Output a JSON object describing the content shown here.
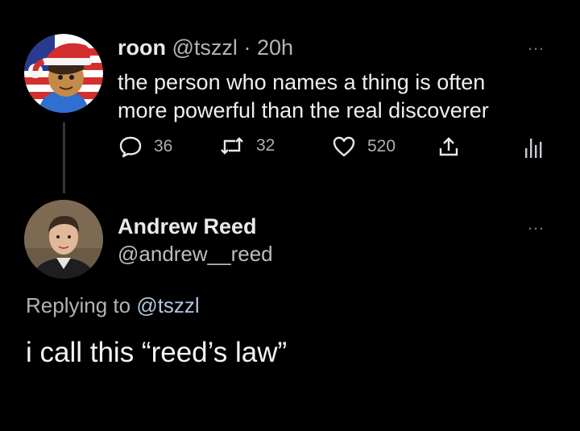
{
  "tweet1": {
    "display_name": "roon",
    "handle": "@tszzl",
    "separator": "·",
    "time": "20h",
    "text_line1": "the person who names a thing is often",
    "text_line2": "more powerful than the real discoverer",
    "replies": "36",
    "retweets": "32",
    "likes": "520",
    "avatar_icon": "santa-hat-cartoon-avatar"
  },
  "tweet2": {
    "display_name": "Andrew Reed",
    "handle": "@andrew__reed",
    "replying_prefix": "Replying to",
    "replying_to": "@tszzl",
    "text": "i call this “reed’s law”",
    "avatar_icon": "profile-photo-avatar"
  },
  "icons": {
    "more": "…",
    "reply": "speech-bubble-icon",
    "retweet": "retweet-arrows-icon",
    "like": "heart-outline-icon",
    "share": "share-upload-icon",
    "stats": "analytics-bars-icon"
  },
  "colors": {
    "background": "#000000",
    "text": "#e7e9ea",
    "muted": "#aab0b5",
    "mention": "#b2c6e0"
  }
}
